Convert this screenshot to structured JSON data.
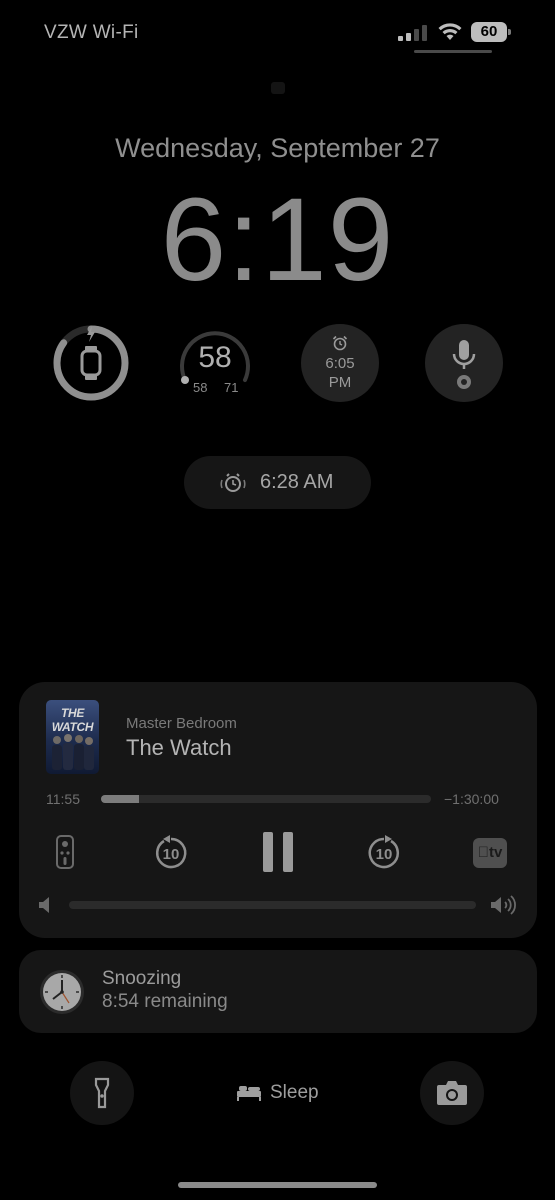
{
  "status_bar": {
    "carrier": "VZW Wi-Fi",
    "battery_level": "60",
    "signal_icon": "cellular-signal-icon",
    "wifi_icon": "wifi-icon"
  },
  "lock_screen": {
    "date": "Wednesday, September 27",
    "time": "6:19"
  },
  "widgets": {
    "battery": {
      "icon": "apple-watch-charging-icon",
      "level": 0.85
    },
    "weather": {
      "temperature": "58",
      "low": "58",
      "high": "71"
    },
    "alarm": {
      "icon": "alarm-clock-icon",
      "time": "6:05",
      "period": "PM"
    },
    "assistant": {
      "icon": "microphone-icon",
      "badge_icon": "chrome-icon"
    }
  },
  "next_alarm": {
    "icon": "alarm-clock-icon",
    "time": "6:28 AM"
  },
  "now_playing": {
    "artwork_title": "THE WATCH",
    "device": "Master Bedroom",
    "title": "The Watch",
    "elapsed": "11:55",
    "remaining": "−1:30:00",
    "progress": 0.115,
    "skip_back_seconds": "10",
    "skip_forward_seconds": "10",
    "app_badge": "tv",
    "volume": 0.0
  },
  "snooze": {
    "title": "Snoozing",
    "subtitle": "8:54 remaining"
  },
  "bottom": {
    "sleep_label": "Sleep"
  },
  "colors": {
    "background": "#000000",
    "card": "#161616",
    "text_primary": "#b4b4b4",
    "text_secondary": "#7a7a7a"
  }
}
